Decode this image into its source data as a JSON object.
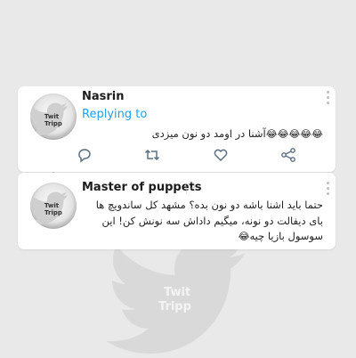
{
  "tweets": [
    {
      "username": "Nasrin",
      "replying_to": "Replying to",
      "text": "آشنا در اومد دو نون میزدی",
      "emoji": "😂😂😂😂😂",
      "avatar_watermark": "Twit Tripp"
    },
    {
      "username": "Master of puppets",
      "flag": "🏳",
      "text": "حتما باید اشنا باشه دو نون بده؟ مشهد کل ساندویچ ها بای دیفالت دو نونه، میگیم داداش سه نونش کن! این سوسول بازیا چیه",
      "emoji": "😂",
      "avatar_watermark": "Twit Tripp"
    }
  ],
  "actions": [
    "reply-icon",
    "retweet-icon",
    "like-icon",
    "share-icon"
  ],
  "watermark": {
    "line1": "Twit",
    "line2": "Tripp"
  },
  "colors": {
    "accent": "#1da1f2",
    "card": "#ffffff",
    "background": "#e9e9e9"
  }
}
